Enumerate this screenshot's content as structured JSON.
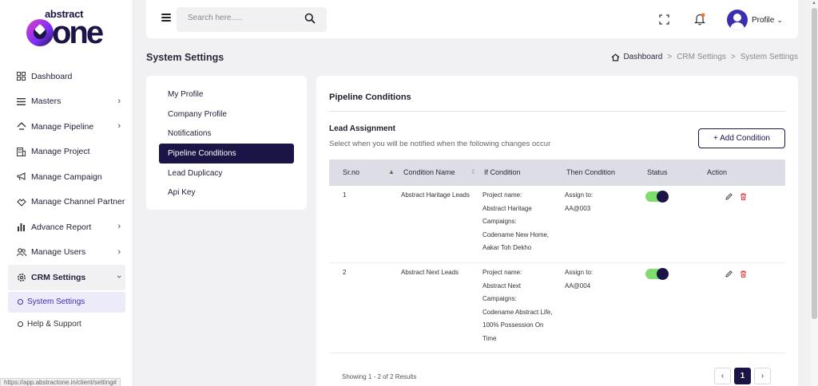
{
  "brand": {
    "top": "abstract",
    "main": "one"
  },
  "sidebar": {
    "items": [
      {
        "label": "Dashboard",
        "icon": "dashboard-icon",
        "has_chevron": false
      },
      {
        "label": "Masters",
        "icon": "list-icon",
        "has_chevron": true
      },
      {
        "label": "Manage Pipeline",
        "icon": "pipeline-icon",
        "has_chevron": true
      },
      {
        "label": "Manage Project",
        "icon": "building-icon",
        "has_chevron": false
      },
      {
        "label": "Manage Campaign",
        "icon": "megaphone-icon",
        "has_chevron": false
      },
      {
        "label": "Manage Channel Partner",
        "icon": "handshake-icon",
        "has_chevron": false
      },
      {
        "label": "Advance Report",
        "icon": "bar-chart-icon",
        "has_chevron": true
      },
      {
        "label": "Manage Users",
        "icon": "users-icon",
        "has_chevron": true
      },
      {
        "label": "CRM Settings",
        "icon": "gear-icon",
        "has_chevron": true
      }
    ],
    "sub_items": [
      {
        "label": "System Settings",
        "active": true
      },
      {
        "label": "Help & Support",
        "active": false
      }
    ]
  },
  "status_url": "https://app.abstractone.in/client/setting#",
  "topbar": {
    "search_placeholder": "Search here.....",
    "profile_label": "Profile"
  },
  "page": {
    "title": "System Settings"
  },
  "breadcrumb": {
    "home": "Dashboard",
    "parent": "CRM Settings",
    "current": "System Settings",
    "separator": ">"
  },
  "settings_menu": [
    {
      "label": "My Profile",
      "active": false
    },
    {
      "label": "Company Profile",
      "active": false
    },
    {
      "label": "Notifications",
      "active": false
    },
    {
      "label": "Pipeline Conditions",
      "active": true
    },
    {
      "label": "Lead Duplicacy",
      "active": false
    },
    {
      "label": "Api Key",
      "active": false
    }
  ],
  "main": {
    "title": "Pipeline Conditions",
    "section_title": "Lead Assignment",
    "section_desc": "Select when you will be notified when the following changes occur",
    "add_button": "+ Add Condition",
    "columns": {
      "srno": "Sr.no",
      "name": "Condition Name",
      "if": "If Condition",
      "then": "Then Condition",
      "status": "Status",
      "action": "Action"
    },
    "rows": [
      {
        "srno": "1",
        "name": "Abstract Haritage Leads",
        "project_label": "Project name:",
        "project": "Abstract Haritage",
        "campaigns_label": "Campaigns:",
        "campaign_lines": [
          "Codename New Home,",
          "Aakar Toh Dekho"
        ],
        "assign_label": "Assign to:",
        "assign": "AA@003",
        "status_on": true
      },
      {
        "srno": "2",
        "name": "Abstract Next Leads",
        "project_label": "Project name:",
        "project": "Abstract Next",
        "campaigns_label": "Campaigns:",
        "campaign_lines": [
          "Codename Abstract Life,",
          "100% Possession On",
          "Time"
        ],
        "assign_label": "Assign to:",
        "assign": "AA@004",
        "status_on": true
      }
    ],
    "results": "Showing 1 - 2 of 2 Results",
    "pagination": {
      "prev": "‹",
      "current": "1",
      "next": "›"
    }
  },
  "colors": {
    "primary": "#1b1446",
    "toggle_on": "#7fdc6e",
    "danger": "#e53935",
    "accent": "#3a2fb0"
  }
}
